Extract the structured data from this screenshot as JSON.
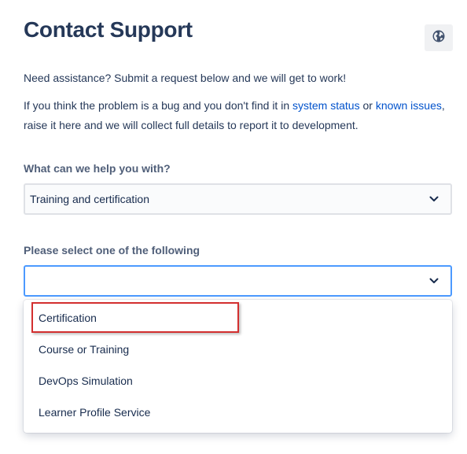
{
  "header": {
    "title": "Contact Support",
    "language_icon": "globe-icon"
  },
  "intro": {
    "line1": "Need assistance? Submit a request below and we will get to work!",
    "bug_prefix": "If you think the problem is a bug and you don't find it in ",
    "system_status_link": "system status",
    "or_text": " or ",
    "known_issues_link": "known issues",
    "bug_suffix": ", raise it here and we will collect full details to report it to development."
  },
  "form": {
    "help_label": "What can we help you with?",
    "help_value": "Training and certification",
    "sub_label": "Please select one of the following",
    "sub_value": "",
    "options": [
      "Certification",
      "Course or Training",
      "DevOps Simulation",
      "Learner Profile Service"
    ],
    "highlighted_option_index": 0
  },
  "colors": {
    "link": "#0052cc",
    "focus_border": "#4c9aff",
    "highlight_box": "#d32f2f"
  }
}
